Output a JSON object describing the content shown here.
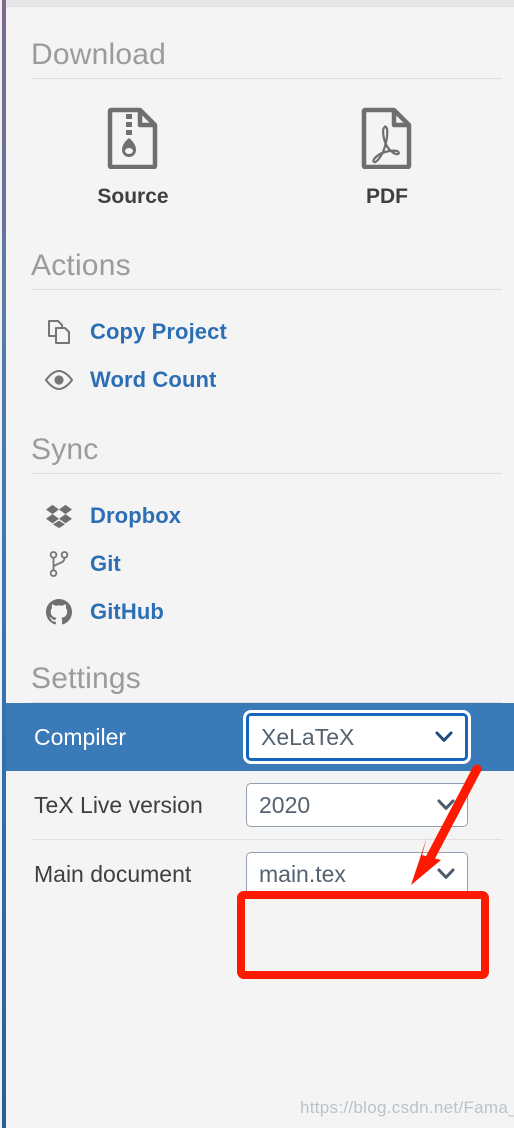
{
  "window": {
    "accent_blue": "#2c6fb5",
    "active_row_bg": "#3b7ab8",
    "annotation_red": "#fc1b00",
    "muted_gray": "#9b9b9b"
  },
  "download": {
    "header": "Download",
    "items": [
      {
        "label": "Source",
        "icon": "zip-file-icon"
      },
      {
        "label": "PDF",
        "icon": "pdf-file-icon"
      }
    ]
  },
  "actions": {
    "header": "Actions",
    "items": [
      {
        "label": "Copy Project",
        "icon": "copy-icon"
      },
      {
        "label": "Word Count",
        "icon": "eye-icon"
      }
    ]
  },
  "sync": {
    "header": "Sync",
    "items": [
      {
        "label": "Dropbox",
        "icon": "dropbox-icon"
      },
      {
        "label": "Git",
        "icon": "git-branch-icon"
      },
      {
        "label": "GitHub",
        "icon": "github-icon"
      }
    ]
  },
  "settings": {
    "header": "Settings",
    "rows": [
      {
        "label": "Compiler",
        "value": "XeLaTeX",
        "highlighted": true
      },
      {
        "label": "TeX Live version",
        "value": "2020",
        "highlighted": false
      },
      {
        "label": "Main document",
        "value": "main.tex",
        "highlighted": false
      }
    ]
  },
  "annotations": {
    "arrow": "red-arrow-pointing-to-compiler-dropdown",
    "box": "red-highlight-box-around-compiler-select"
  },
  "watermark": "https://blog.csdn.net/Fama_Q"
}
